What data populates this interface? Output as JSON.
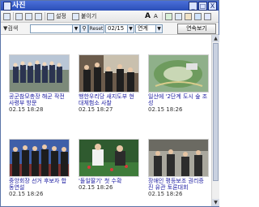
{
  "window": {
    "title": "사진",
    "buttons": [
      "_",
      "□",
      "X"
    ]
  },
  "toolbar": {
    "settings_label": "설정",
    "paste_label": "붙이기",
    "font_up": "A",
    "font_down": "A"
  },
  "search": {
    "label": "▼검색",
    "value": "",
    "reset_label": "Reset",
    "date": "02/15",
    "scope": "연계",
    "continue_label": "연속보기"
  },
  "photos": [
    {
      "caption": "공군참모총장 해군 작전사령부 방문",
      "time": "02.15 18:28"
    },
    {
      "caption": "행한우리당 새지도부 현대체험소 사찰",
      "time": "02.15 18:27"
    },
    {
      "caption": "일산에 '2단계 도시 숲 조성",
      "time": "02.15 18:26"
    },
    {
      "caption": "중앙회장 선거 후보자 합동연설",
      "time": "02.15 18:26"
    },
    {
      "caption": "'돌일딸기' 첫 수확",
      "time": "02.15 18:26"
    },
    {
      "caption": "장애인 평등보조 권리증진 유관 토론대회",
      "time": "02.15 18:26"
    }
  ]
}
